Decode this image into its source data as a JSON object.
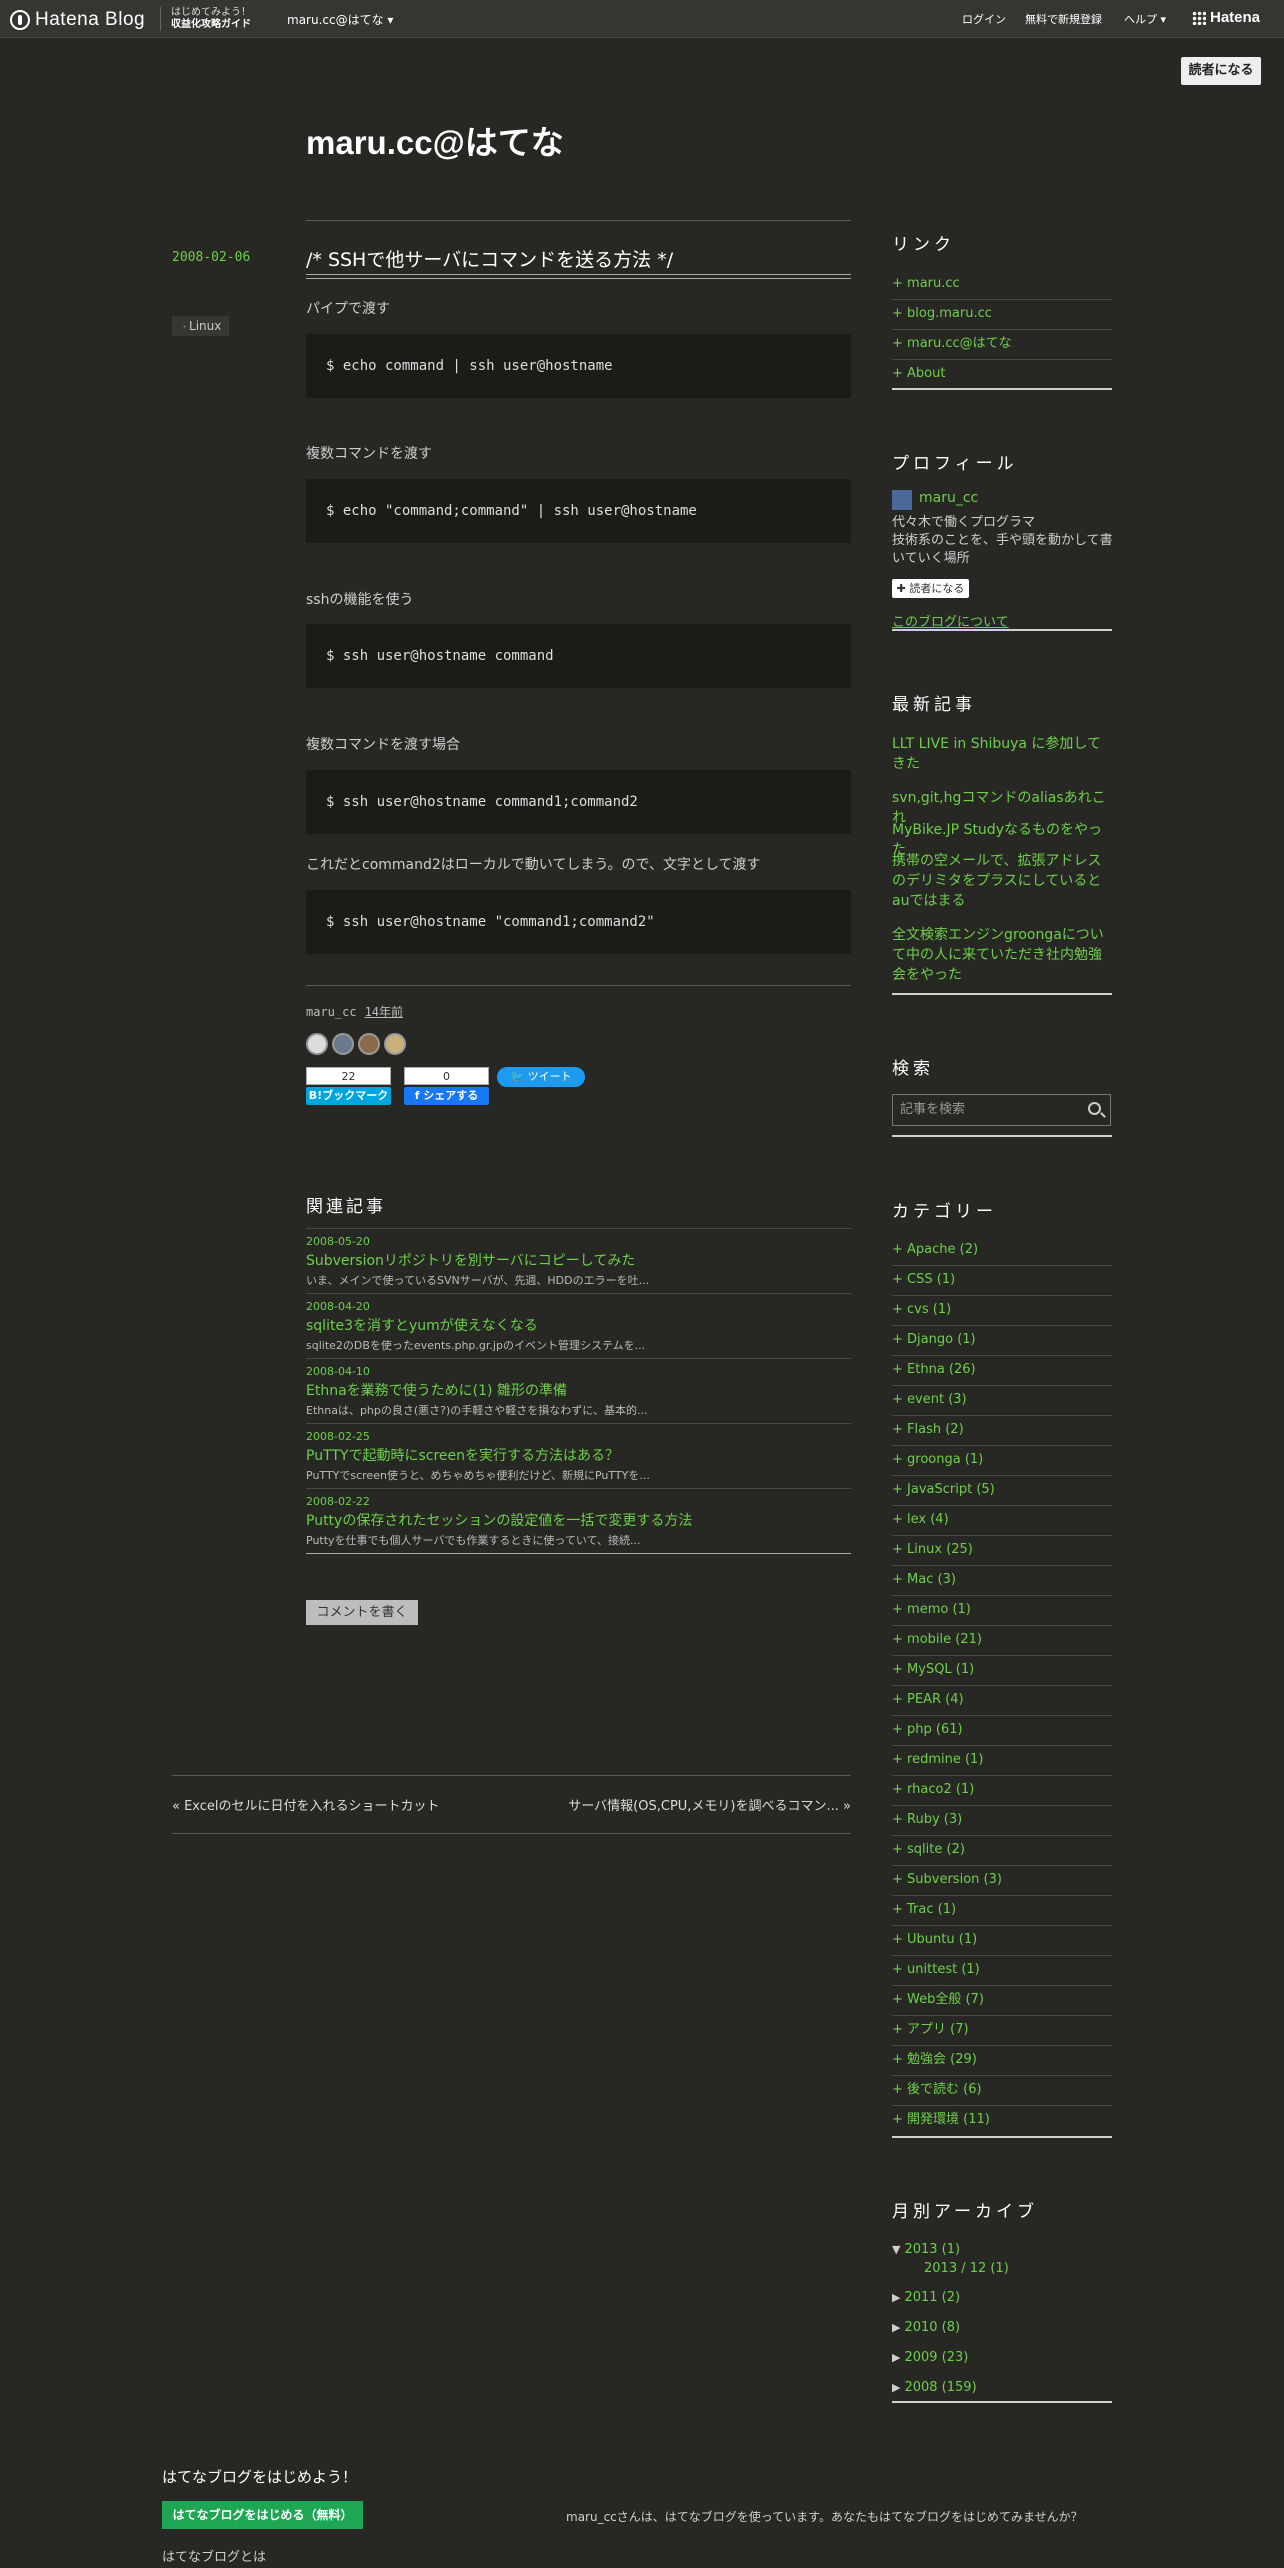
{
  "topbar": {
    "logo_text": "Hatena Blog",
    "promo_line1": "はじめてみよう！",
    "promo_line2": "収益化攻略ガイド",
    "blog_name": "maru.cc@はてな ▾",
    "login": "ログイン",
    "signup": "無料で新規登録",
    "help": "ヘルプ ▾",
    "hatena": "Hatena"
  },
  "reader_button": "読者になる",
  "site_title": "maru.cc@はてな",
  "entry": {
    "date": "2008-02-06",
    "title": "/* SSHで他サーバにコマンドを送る方法 */",
    "category": "Linux",
    "blocks": [
      {
        "text": "パイプで渡す",
        "code": "$ echo command | ssh user@hostname"
      },
      {
        "text": "複数コマンドを渡す",
        "code": "$ echo \"command;command\" | ssh user@hostname"
      },
      {
        "text": "sshの機能を使う",
        "code": "$ ssh user@hostname command"
      },
      {
        "text": "複数コマンドを渡す場合",
        "code": "$ ssh user@hostname command1;command2"
      },
      {
        "text": "これだとcommand2はローカルで動いてしまう。ので、文字として渡す",
        "code": "$ ssh user@hostname \"command1;command2\""
      }
    ],
    "author": "maru_cc",
    "time_ago": "14年前",
    "bookmark_count": "22",
    "bookmark_label": "B!ブックマーク",
    "share_count": "0",
    "share_label": "f  シェアする",
    "tweet_label": "ツイート"
  },
  "related": {
    "heading": "関連記事",
    "items": [
      {
        "date": "2008-05-20",
        "title": "Subversionリポジトリを別サーバにコピーしてみた",
        "snippet": "いま、メインで使っているSVNサーバが、先週、HDDのエラーを吐..."
      },
      {
        "date": "2008-04-20",
        "title": "sqlite3を消すとyumが使えなくなる",
        "snippet": "sqlite2のDBを使ったevents.php.gr.jpのイベント管理システムを..."
      },
      {
        "date": "2008-04-10",
        "title": "Ethnaを業務で使うために(1) 雛形の準備",
        "snippet": "Ethnaは、phpの良さ(悪さ?)の手軽さや軽さを損なわずに、基本的..."
      },
      {
        "date": "2008-02-25",
        "title": "PuTTYで起動時にscreenを実行する方法はある？",
        "snippet": "PuTTYでscreen使うと、めちゃめちゃ便利だけど、新規にPuTTYを..."
      },
      {
        "date": "2008-02-22",
        "title": "Puttyの保存されたセッションの設定値を一括で変更する方法",
        "snippet": "Puttyを仕事でも個人サーバでも作業するときに使っていて、接続..."
      }
    ]
  },
  "comment_button": "コメントを書く",
  "pager": {
    "prev": "« Excelのセルに日付を入れるショートカット",
    "next": "サーバ情報(OS,CPU,メモリ)を調べるコマン... »"
  },
  "sidebar": {
    "links_heading": "リンク",
    "links": [
      "maru.cc",
      "blog.maru.cc",
      "maru.cc@はてな",
      "About"
    ],
    "profile_heading": "プロフィール",
    "profile_name": "maru_cc",
    "profile_desc": "代々木で働くプログラマ\n技術系のことを、手や頭を動かして書いていく場所",
    "profile_reader": "読者になる",
    "profile_about": "このブログについて",
    "recent_heading": "最新記事",
    "recent": [
      "LLT LIVE in Shibuya に参加してきた",
      "svn,git,hgコマンドのaliasあれこれ",
      "MyBike.JP Studyなるものをやった",
      "携帯の空メールで、拡張アドレスのデリミタをプラスにしているとauではまる",
      "全文検索エンジンgroongaについて中の人に来ていただき社内勉強会をやった"
    ],
    "search_heading": "検索",
    "search_placeholder": "記事を検索",
    "category_heading": "カテゴリー",
    "categories": [
      "Apache (2)",
      "CSS (1)",
      "cvs (1)",
      "Django (1)",
      "Ethna (26)",
      "event (3)",
      "Flash (2)",
      "groonga (1)",
      "JavaScript (5)",
      "lex (4)",
      "Linux (25)",
      "Mac (3)",
      "memo (1)",
      "mobile (21)",
      "MySQL (1)",
      "PEAR (4)",
      "php (61)",
      "redmine (1)",
      "rhaco2 (1)",
      "Ruby (3)",
      "sqlite (2)",
      "Subversion (3)",
      "Trac (1)",
      "Ubuntu (1)",
      "unittest (1)",
      "Web全般 (7)",
      "アプリ (7)",
      "勉強会 (29)",
      "後で読む (6)",
      "開発環境 (11)"
    ],
    "archive_heading": "月別アーカイブ",
    "archive": [
      {
        "label": "2013 (1)",
        "open": true,
        "sub": "2013 / 12 (1)"
      },
      {
        "label": "2011 (2)"
      },
      {
        "label": "2010 (8)"
      },
      {
        "label": "2009 (23)"
      },
      {
        "label": "2008 (159)"
      }
    ]
  },
  "footer": {
    "heading": "はてなブログをはじめよう！",
    "button": "はてなブログをはじめる（無料）",
    "text": "maru_ccさんは、はてなブログを使っています。あなたもはてなブログをはじめてみませんか？",
    "about": "はてなブログとは"
  }
}
